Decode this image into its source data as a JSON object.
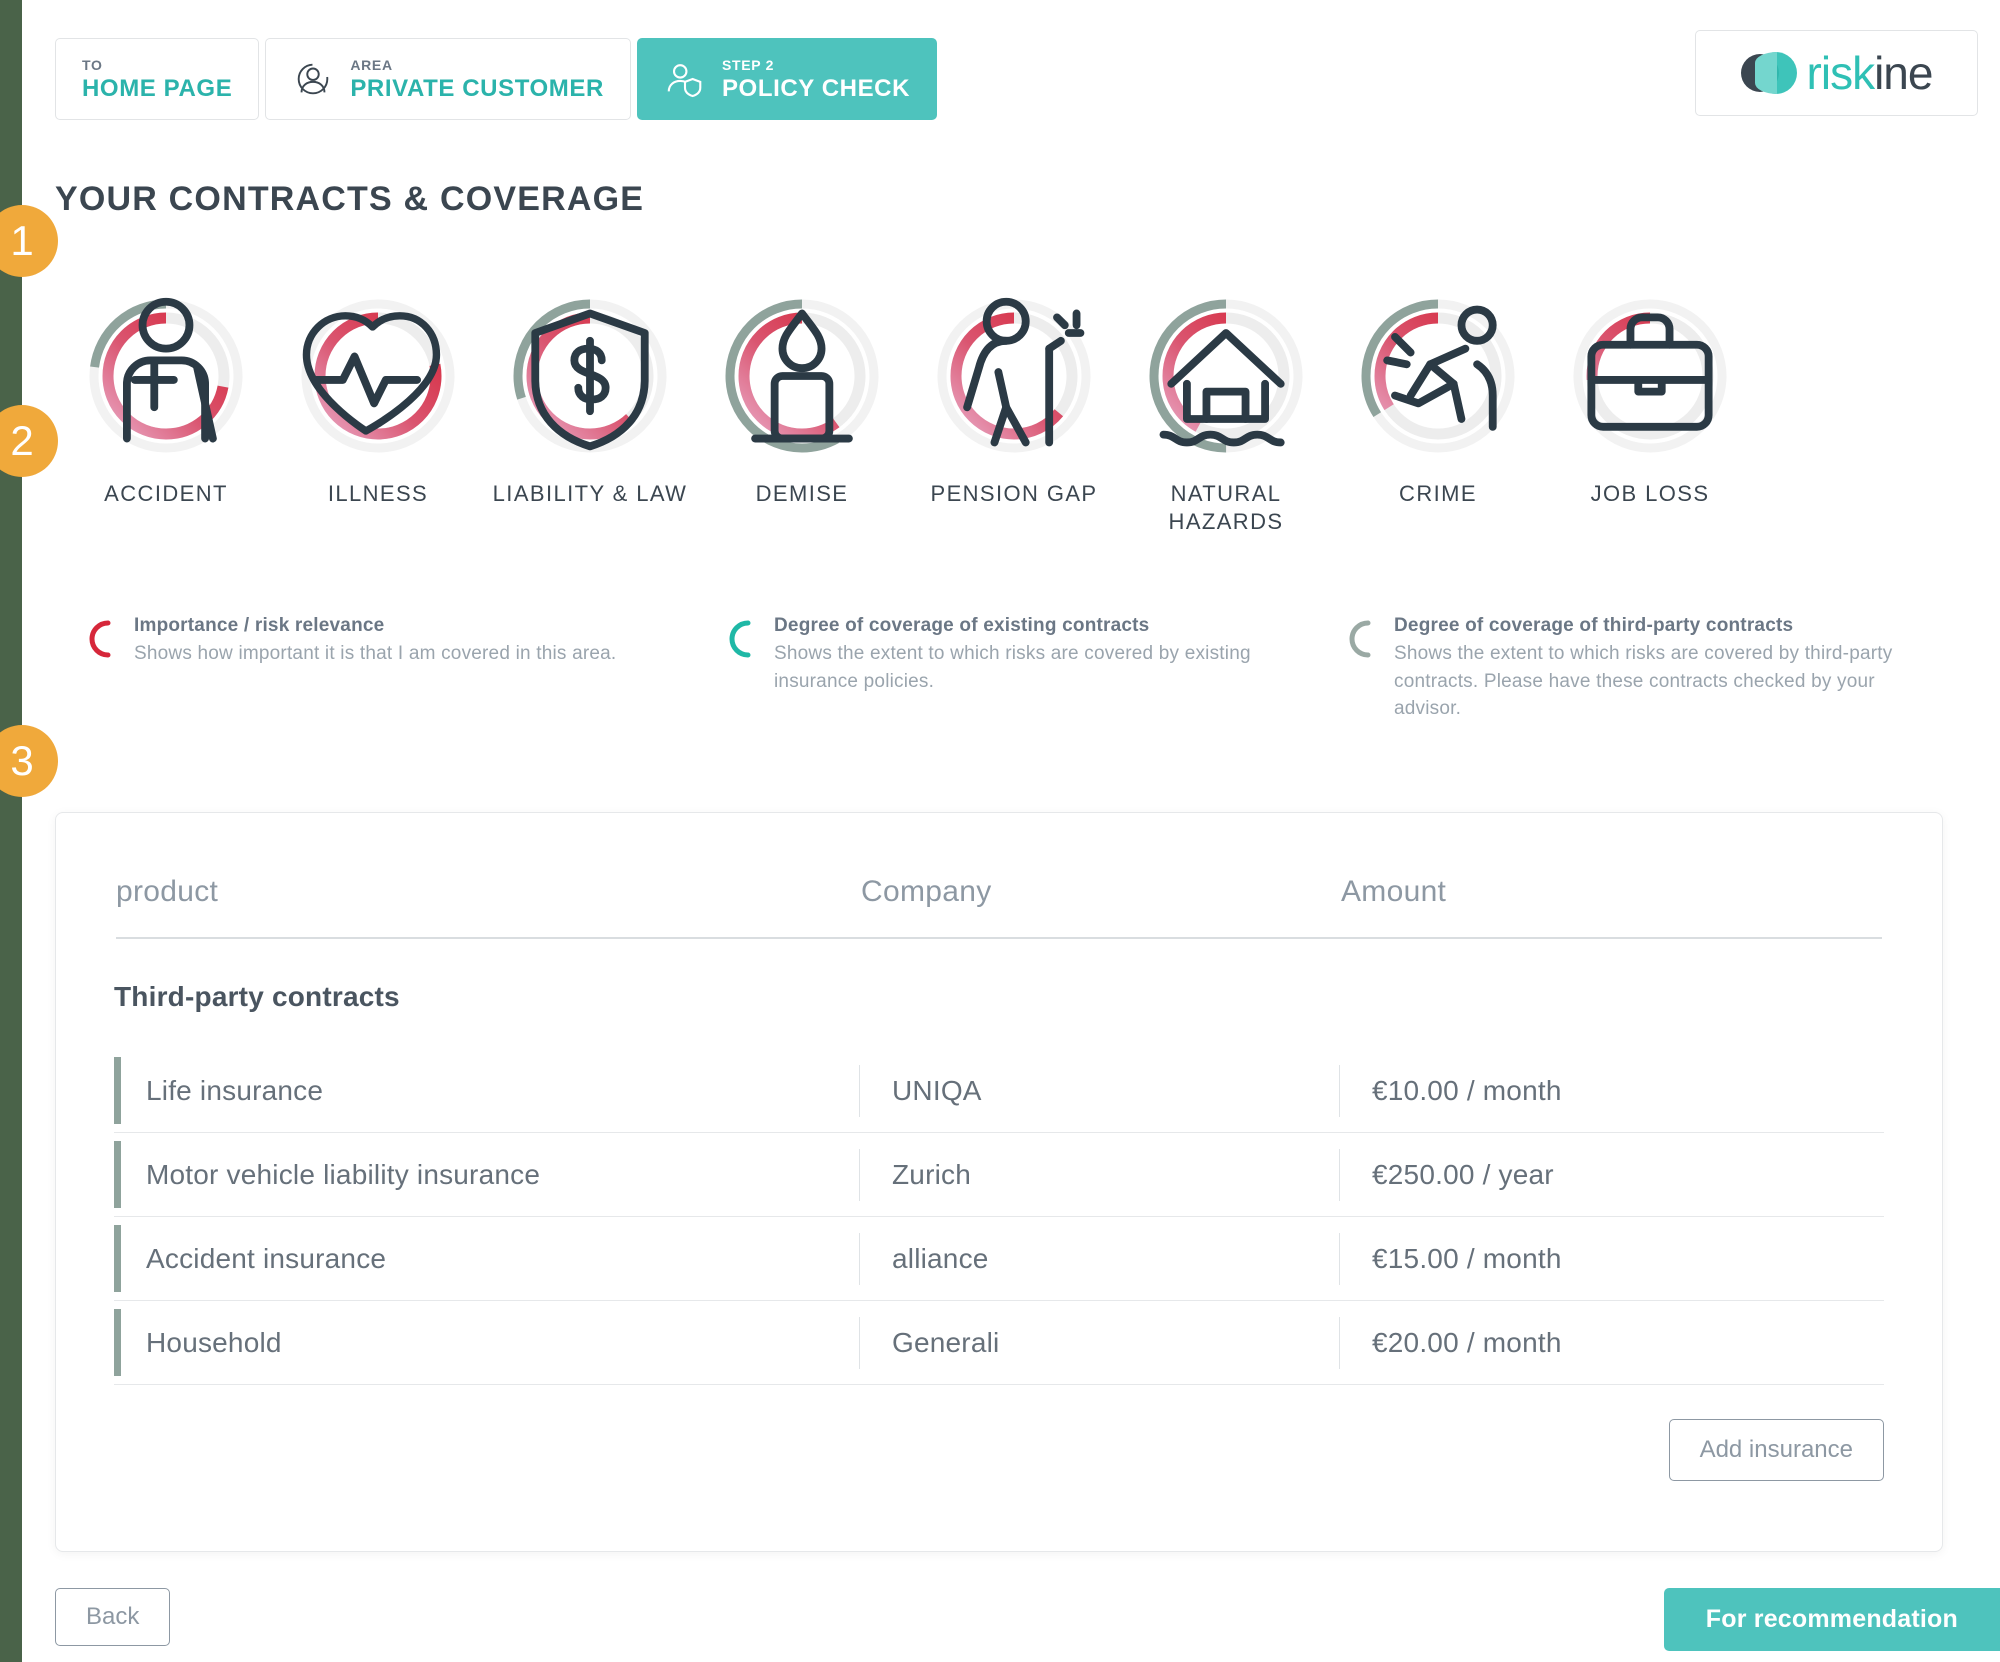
{
  "breadcrumbs": [
    {
      "sub": "TO",
      "main": "HOME PAGE",
      "icon": "none",
      "active": false
    },
    {
      "sub": "AREA",
      "main": "PRIVATE CUSTOMER",
      "icon": "person-icon",
      "active": false
    },
    {
      "sub": "STEP 2",
      "main": "POLICY CHECK",
      "icon": "person-shield-icon",
      "active": true
    }
  ],
  "logo": {
    "part1": "risk",
    "part2": "ine",
    "mark": "riskine-logo-icon"
  },
  "page_title": "YOUR CONTRACTS & COVERAGE",
  "steps": {
    "one": "1",
    "two": "2",
    "three": "3"
  },
  "colors": {
    "accent_teal": "#4ec3bd",
    "accent_orange": "#f0a93b",
    "risk_red": "#d6273a",
    "risk_pink": "#e9a7c4",
    "coverage_teal": "#1fb8a6",
    "third_party_gray": "#8fa39c",
    "track_gray": "#ededed",
    "edge_green": "#4a6349"
  },
  "gauges": [
    {
      "label": "ACCIDENT",
      "icon": "person-injured-icon",
      "risk_pct": 72,
      "existing_pct": 0,
      "third_pct": 23
    },
    {
      "label": "ILLNESS",
      "icon": "heart-pulse-icon",
      "risk_pct": 78,
      "existing_pct": 0,
      "third_pct": 0
    },
    {
      "label": "LIABILITY & LAW",
      "icon": "shield-paragraph-icon",
      "risk_pct": 62,
      "existing_pct": 0,
      "third_pct": 30
    },
    {
      "label": "DEMISE",
      "icon": "candle-icon",
      "risk_pct": 60,
      "existing_pct": 0,
      "third_pct": 58
    },
    {
      "label": "PENSION GAP",
      "icon": "elderly-person-icon",
      "risk_pct": 64,
      "existing_pct": 0,
      "third_pct": 0
    },
    {
      "label": "NATURAL HAZARDS",
      "icon": "flooded-house-icon",
      "risk_pct": 42,
      "existing_pct": 0,
      "third_pct": 50
    },
    {
      "label": "CRIME",
      "icon": "burglar-icon",
      "risk_pct": 34,
      "existing_pct": 0,
      "third_pct": 34
    },
    {
      "label": "JOB LOSS",
      "icon": "briefcase-icon",
      "risk_pct": 26,
      "existing_pct": 0,
      "third_pct": 0
    }
  ],
  "legend": [
    {
      "arc_color": "#d6273a",
      "title": "Importance / risk relevance",
      "desc": "Shows how important it is that I am covered in this area."
    },
    {
      "arc_color": "#1fb8a6",
      "title": "Degree of coverage of existing contracts",
      "desc": "Shows the extent to which risks are covered by existing insurance policies."
    },
    {
      "arc_color": "#9aa9a4",
      "title": "Degree of coverage of third-party contracts",
      "desc": "Shows the extent to which risks are covered by third-party contracts. Please have these contracts checked by your advisor."
    }
  ],
  "table": {
    "headers": {
      "product": "product",
      "company": "Company",
      "amount": "Amount"
    },
    "group_title": "Third-party contracts",
    "rows": [
      {
        "product": "Life insurance",
        "company": "UNIQA",
        "amount": "€10.00 / month"
      },
      {
        "product": "Motor vehicle liability insurance",
        "company": "Zurich",
        "amount": "€250.00 / year"
      },
      {
        "product": "Accident insurance",
        "company": "alliance",
        "amount": "€15.00 / month"
      },
      {
        "product": "Household",
        "company": "Generali",
        "amount": "€20.00 / month"
      }
    ],
    "add_button": "Add insurance"
  },
  "footer": {
    "back": "Back",
    "recommend": "For recommendation"
  }
}
